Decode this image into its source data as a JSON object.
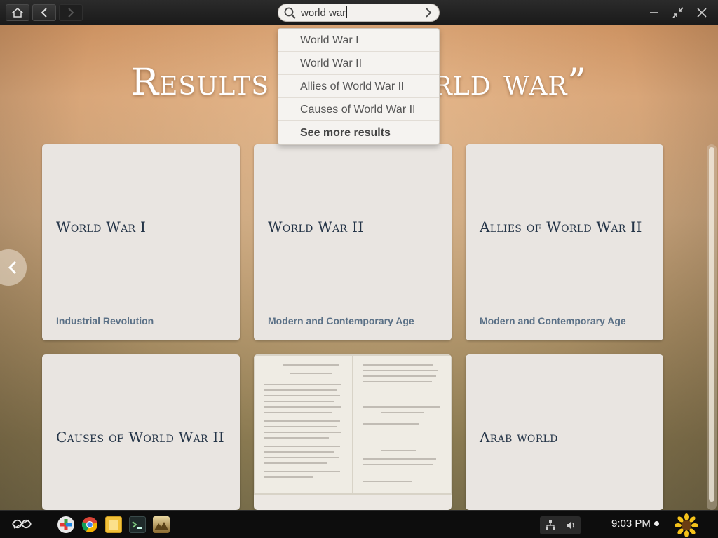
{
  "search": {
    "value": "world war"
  },
  "page_title": "Results for “World war”",
  "suggestions": [
    "World War I",
    "World War II",
    "Allies of World War II",
    "Causes of World War II",
    "See more results"
  ],
  "cards": [
    {
      "title": "World War I",
      "subtitle": "Industrial Revolution"
    },
    {
      "title": "World War II",
      "subtitle": "Modern and Contemporary Age"
    },
    {
      "title": "Allies of World War II",
      "subtitle": "Modern and Contemporary Age"
    },
    {
      "title": "Causes of World War II",
      "subtitle": ""
    },
    {
      "title": "",
      "subtitle": ""
    },
    {
      "title": "Arab world",
      "subtitle": ""
    }
  ],
  "taskbar": {
    "time": "9:03 PM"
  },
  "colors": {
    "card_title": "#243447",
    "card_subtitle": "#5a7086",
    "card_bg": "#e9e5e1"
  }
}
